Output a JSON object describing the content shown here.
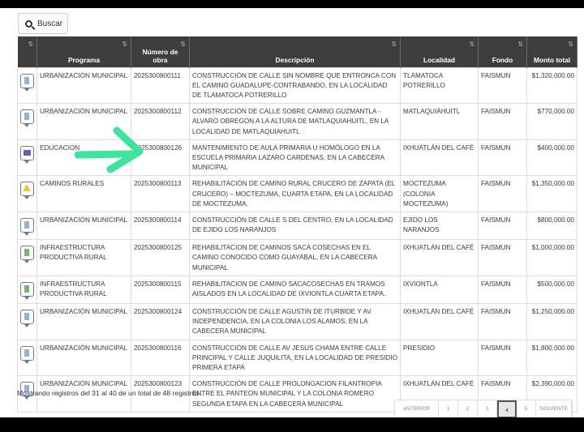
{
  "search": {
    "label": "Buscar"
  },
  "table": {
    "headers": [
      "Programa",
      "Número de obra",
      "Descripción",
      "Localidad",
      "Fondo",
      "Monto total"
    ],
    "rows": [
      {
        "icon": "building-icon",
        "programa": "URBANIZACIÓN MUNICIPAL",
        "numero": "2025300800111",
        "descripcion": "CONSTRUCCIÓN DE CALLE SIN NOMBRE QUE ENTRONCA CON EL CAMINO GUADALUPE-CONTRABANDO, EN LA LOCALIDAD DE TLAMATOCA POTRERILLO",
        "localidad": "TLAMATOCA POTRERILLO",
        "fondo": "FAISMUN",
        "monto": "$1,320,000.00"
      },
      {
        "icon": "building-icon",
        "programa": "URBANIZACIÓN MUNICIPAL",
        "numero": "2025300800112",
        "descripcion": "CONSTRUCCIÓN DE CALLE SOBRE CAMINO GUZMANTLA - ALVARO OBREGON A LA ALTURA DE MATLAQUIAHUITL, EN LA LOCALIDAD DE MATLAQUIAHUITL",
        "localidad": "MATLAQUIÁHUITL",
        "fondo": "FAISMUN",
        "monto": "$770,000.00"
      },
      {
        "icon": "school-icon",
        "programa": "EDUCACION",
        "numero": "2025300800126",
        "descripcion": "MANTENIMIENTO DE AULA PRIMARIA U HOMÓLOGO EN LA ESCUELA PRIMARIA LAZARO CARDENAS, EN LA CABECERA MUNICIPAL",
        "localidad": "IXHUATLÁN DEL CAFÉ",
        "fondo": "FAISMUN",
        "monto": "$400,000.00"
      },
      {
        "icon": "road-icon",
        "programa": "CAMINOS RURALES",
        "numero": "2025300800113",
        "descripcion": "REHABILITACIÓN DE CAMINO RURAL CRUCERO DE ZAPATA (EL CRUCERO) – MOCTEZUMA, CUARTA ETAPA, EN LA LOCALIDAD DE MOCTEZUMA.",
        "localidad": "MOCTEZUMA (COLONIA MOCTEZUMA)",
        "fondo": "FAISMUN",
        "monto": "$1,350,000.00"
      },
      {
        "icon": "building-icon",
        "programa": "URBANIZACIÓN MUNICIPAL",
        "numero": "2025300800114",
        "descripcion": "CONSTRUCCIÓN DE CALLE S DEL CENTRO, EN LA LOCALIDAD DE EJIDO LOS NARANJOS",
        "localidad": "EJIDO LOS NARANJOS",
        "fondo": "FAISMUN",
        "monto": "$800,000.00"
      },
      {
        "icon": "rural-icon",
        "programa": "INFRAESTRUCTURA PRODUCTIVA RURAL",
        "numero": "2025300800125",
        "descripcion": "REHABILITACION DE CAMINOS SACA COSECHAS EN EL CAMINO CONOCIDO COMO GUAYABAL, EN LA CABECERA MUNICIPAL",
        "localidad": "IXHUATLÁN DEL CAFÉ",
        "fondo": "FAISMUN",
        "monto": "$1,000,000.00"
      },
      {
        "icon": "rural-icon",
        "programa": "INFRAESTRUCTURA PRODUCTIVA RURAL",
        "numero": "2025300800115",
        "descripcion": "REHABILITACION DE CAMINO SACACOSECHAS EN TRAMOS AISLADOS EN LA LOCALIDAD DE IXVIONTLA CUARTA ETAPA.",
        "localidad": "IXVIONTLA",
        "fondo": "FAISMUN",
        "monto": "$500,000.00"
      },
      {
        "icon": "building-icon",
        "programa": "URBANIZACIÓN MUNICIPAL",
        "numero": "2025300800124",
        "descripcion": "CONSTRUCCIÓN DE CALLE AGUSTIN DE ITURBIDE Y AV. INDEPENDENCIA, EN LA COLONIA LOS ALAMOS, EN LA CABECERA MUNICIPAL",
        "localidad": "IXHUATLÁN DEL CAFÉ",
        "fondo": "FAISMUN",
        "monto": "$1,250,000.00"
      },
      {
        "icon": "building-icon",
        "programa": "URBANIZACIÓN MUNICIPAL",
        "numero": "2025300800116",
        "descripcion": "CONSTRUCCIÓN DE CALLE AV JESUS CHAMA ENTRE CALLE PRINCIPAL Y CALLE JUQUILITA, EN LA LOCALIDAD DE PRESIDIO PRIMERA ETAPA",
        "localidad": "PRESIDIO",
        "fondo": "FAISMUN",
        "monto": "$1,800,000.00"
      },
      {
        "icon": "building-icon",
        "programa": "URBANIZACIÓN MUNICIPAL",
        "numero": "2025300800123",
        "descripcion": "CONSTRUCCIÓN DE CALLE PROLONGACION FILANTROPIA ENTRE EL PANTEON MUNICIPAL Y LA COLONIA ROMERO SEGUNDA ETAPA EN LA CABECERA MUNICIPAL",
        "localidad": "IXHUATLÁN DEL CAFÉ",
        "fondo": "FAISMUN",
        "monto": "$2,390,000.00"
      }
    ]
  },
  "footer": {
    "info": "Mostrando registros del 31 al 40 de un total de 48 registros"
  },
  "pagination": {
    "items": [
      "ANTERIOR",
      "1",
      "2",
      "3",
      "4",
      "5",
      "SIGUIENTE"
    ],
    "active": "4"
  },
  "annotation": {
    "color": "#3fe39a"
  }
}
